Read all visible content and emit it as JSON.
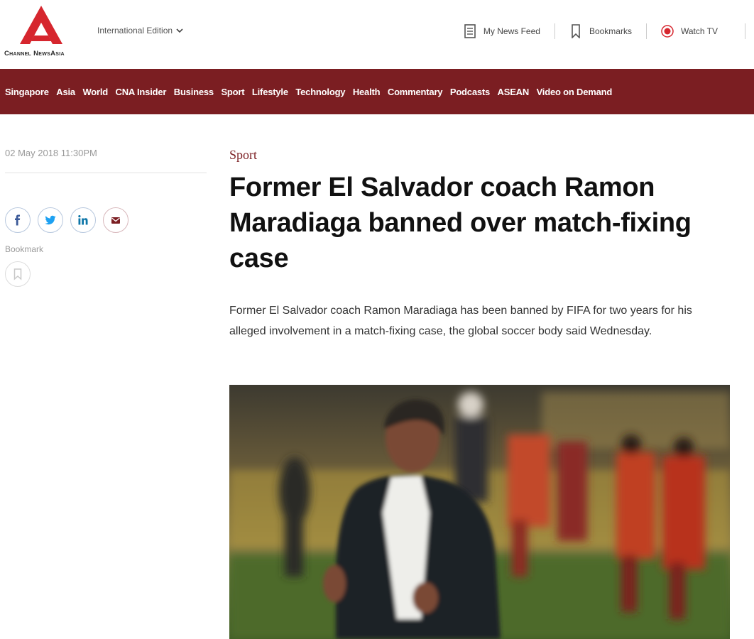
{
  "header": {
    "logo_text": "Channel NewsAsia",
    "edition_label": "International Edition",
    "actions": {
      "news_feed": "My News Feed",
      "bookmarks": "Bookmarks",
      "watch_tv": "Watch TV"
    }
  },
  "nav": {
    "items": [
      "Singapore",
      "Asia",
      "World",
      "CNA Insider",
      "Business",
      "Sport",
      "Lifestyle",
      "Technology",
      "Health",
      "Commentary",
      "Podcasts",
      "ASEAN",
      "Video on Demand"
    ]
  },
  "sidebar": {
    "date": "02 May 2018 11:30PM",
    "share_icons": [
      "facebook-icon",
      "twitter-icon",
      "linkedin-icon",
      "email-icon"
    ],
    "bookmark_label": "Bookmark"
  },
  "article": {
    "category": "Sport",
    "headline": "Former El Salvador coach Ramon Maradiaga banned over match-fixing case",
    "standfirst": "Former El Salvador coach Ramon Maradiaga has been banned by FIFA for two years for his alleged involvement in a match-fixing case, the global soccer body said Wednesday."
  },
  "colors": {
    "brand_red": "#7b1e22",
    "logo_red": "#d6262e"
  }
}
